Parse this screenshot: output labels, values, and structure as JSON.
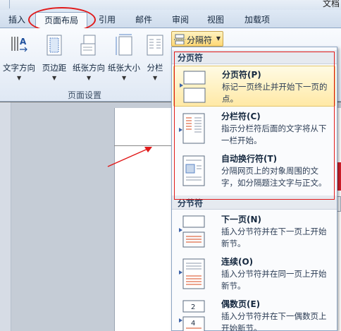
{
  "window": {
    "title_fragment": "文档"
  },
  "ribbon_tabs": [
    {
      "label": "插入"
    },
    {
      "label": "页面布局"
    },
    {
      "label": "引用"
    },
    {
      "label": "邮件"
    },
    {
      "label": "审阅"
    },
    {
      "label": "视图"
    },
    {
      "label": "加载项"
    }
  ],
  "page_setup_group": {
    "label": "页面设置",
    "buttons": [
      {
        "label": "文字方向",
        "icon": "text-direction-icon"
      },
      {
        "label": "页边距",
        "icon": "margins-icon"
      },
      {
        "label": "纸张方向",
        "icon": "orientation-icon"
      },
      {
        "label": "纸张大小",
        "icon": "paper-size-icon"
      },
      {
        "label": "分栏",
        "icon": "columns-icon"
      }
    ],
    "breaks_button": {
      "label": "分隔符",
      "icon": "breaks-icon"
    }
  },
  "breaks_menu": {
    "page_breaks_header": "分页符",
    "page_breaks": [
      {
        "title": "分页符(P)",
        "description": "标记一页终止并开始下一页的点。",
        "icon": "page-break-icon"
      },
      {
        "title": "分栏符(C)",
        "description": "指示分栏符后面的文字将从下一栏开始。",
        "icon": "column-break-icon"
      },
      {
        "title": "自动换行符(T)",
        "description": "分隔网页上的对象周围的文字，如分隔题注文字与正文。",
        "icon": "text-wrapping-break-icon"
      }
    ],
    "section_breaks_header": "分节符",
    "section_breaks": [
      {
        "title": "下一页(N)",
        "description": "插入分节符并在下一页上开始新节。",
        "icon": "next-page-section-icon"
      },
      {
        "title": "连续(O)",
        "description": "插入分节符并在同一页上开始新节。",
        "icon": "continuous-section-icon"
      },
      {
        "title": "偶数页(E)",
        "description": "插入分节符并在下一偶数页上开始新节。",
        "icon": "even-page-section-icon",
        "icon_numbers": [
          "2",
          "4"
        ]
      }
    ]
  },
  "colors": {
    "annotation": "#e11919",
    "highlight": "#ffe9a6",
    "ribbon": "#dfe8f4"
  }
}
